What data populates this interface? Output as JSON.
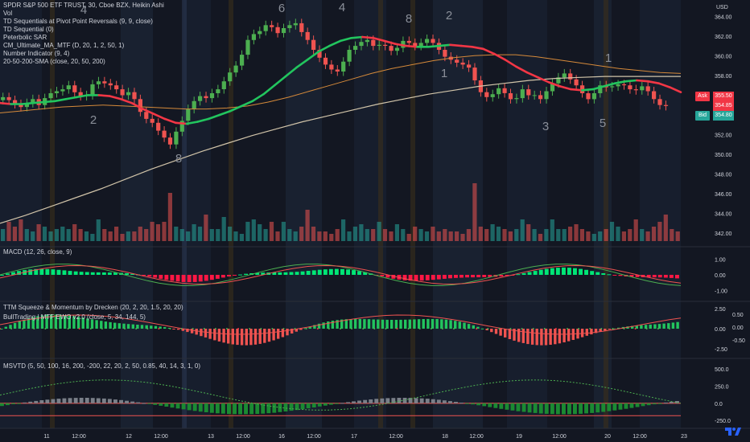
{
  "legend": {
    "title": "SPDR S&P 500 ETF TRUST, 30, Cboe BZX, Heikin Ashi",
    "lines": [
      "Vol",
      "TD Sequentials at Pivot Point Reversals (9, 9, close)",
      "TD Sequential (0)",
      "Peterbolic SAR",
      "CM_Ultimate_MA_MTF (D, 20, 1, 2, 50, 1)",
      "Number Indicator (9, 4)",
      "20-50-200-SMA (close, 20, 50, 200)"
    ]
  },
  "panes": {
    "price": {
      "currency": "USD",
      "ticks": [
        "364.00",
        "362.00",
        "360.00",
        "358.00",
        "356.00",
        "354.00",
        "352.00",
        "350.00",
        "348.00",
        "346.00",
        "344.00",
        "342.00"
      ],
      "tick_values": [
        364,
        362,
        360,
        358,
        356,
        354,
        352,
        350,
        348,
        346,
        344,
        342
      ],
      "range": [
        341.2,
        365
      ]
    },
    "macd": {
      "title": "MACD (12, 26, close, 9)",
      "ticks": [
        "1.00",
        "0.00",
        "-1.00"
      ],
      "tick_values": [
        1,
        0,
        -1
      ],
      "range": [
        -1.45,
        1.45
      ]
    },
    "ttm": {
      "title": "TTM Squeeze & Momentum by Drecken (20, 2, 20, 1.5, 20, 20)",
      "subtitle": "BullTrading | MTF EWO v2.0 (close, 5, 34, 144, 5)",
      "ticks": [
        "2.50",
        "0.00",
        "-2.50"
      ],
      "tick_values": [
        2.5,
        0,
        -2.5
      ],
      "right_ticks": [
        "0.50",
        "0.00",
        "-0.50"
      ],
      "right_values": [
        0.5,
        0,
        -0.5
      ],
      "range": [
        -3.3,
        3.3
      ]
    },
    "msvtd": {
      "title": "MSVTD (5, 50, 100, 16, 200, -200, 22, 20, 2, 50, 0.85, 40, 14, 3, 1, 0)",
      "ticks": [
        "500.0",
        "250.0",
        "0.0",
        "-250.0"
      ],
      "tick_values": [
        500,
        250,
        0,
        -250
      ],
      "range": [
        -330,
        560
      ]
    }
  },
  "price_tags": {
    "ask_label": "Ask",
    "ask": "355.50",
    "last": "354.85",
    "bid_label": "Bid",
    "bid": "354.80",
    "ask_color": "#f23645",
    "bid_color": "#26a69a"
  },
  "time_axis": {
    "labels": [
      "11",
      "12:00",
      "12",
      "12:00",
      "13",
      "12:00",
      "16",
      "12:00",
      "17",
      "12:00",
      "18",
      "12:00",
      "19",
      "12:00",
      "20",
      "12:00",
      "23"
    ]
  },
  "td_labels": [
    "4",
    "2",
    "8",
    "6",
    "4",
    "8",
    "2",
    "1",
    "3",
    "5",
    "1"
  ],
  "colors": {
    "up": "#4caf50",
    "down": "#ef5350",
    "ma_green": "#22c55e",
    "ma_red": "#f23645",
    "sma200": "#d1c4a9",
    "sma50": "#d68a3a",
    "bg": "#131722"
  },
  "chart_data": {
    "type": "candlestick",
    "title": "SPDR S&P 500 ETF TRUST, 30, Cboe BZX, Heikin Ashi",
    "interval": "30",
    "x": [
      "11",
      "12:00",
      "12",
      "12:00",
      "13",
      "12:00",
      "16",
      "12:00",
      "17",
      "12:00",
      "18",
      "12:00",
      "19",
      "12:00",
      "20",
      "12:00",
      "23"
    ],
    "close_path": [
      355.8,
      355.5,
      355.1,
      354.8,
      355.2,
      355.6,
      355.0,
      355.7,
      356.2,
      356.4,
      356.6,
      357.0,
      356.3,
      355.9,
      356.0,
      357.1,
      357.4,
      357.2,
      357.0,
      356.6,
      356.0,
      356.3,
      355.6,
      354.3,
      353.6,
      353.2,
      352.4,
      351.7,
      351.0,
      352.3,
      353.4,
      354.6,
      355.4,
      355.9,
      355.7,
      356.2,
      356.6,
      357.4,
      358.3,
      359.0,
      360.1,
      361.6,
      362.2,
      362.5,
      363.1,
      362.9,
      362.3,
      362.8,
      363.1,
      363.3,
      362.4,
      361.6,
      360.6,
      359.8,
      359.1,
      358.6,
      358.4,
      359.4,
      360.6,
      361.0,
      361.4,
      361.6,
      361.0,
      361.1,
      361.0,
      360.5,
      360.8,
      361.5,
      361.3,
      361.0,
      361.3,
      361.7,
      361.3,
      360.6,
      359.9,
      359.6,
      359.3,
      359.1,
      358.8,
      357.5,
      356.3,
      355.8,
      356.1,
      356.7,
      356.2,
      355.6,
      355.7,
      356.6,
      356.0,
      356.0,
      355.6,
      356.4,
      357.2,
      357.8,
      358.2,
      357.6,
      357.0,
      356.2,
      355.6,
      356.2,
      357.0,
      356.8,
      356.9,
      357.1,
      357.0,
      356.6,
      356.5,
      356.9,
      356.4,
      355.6,
      355.0,
      354.9
    ],
    "volume": [
      5,
      8,
      6,
      9,
      5,
      4,
      7,
      6,
      4,
      5,
      6,
      5,
      7,
      5,
      4,
      3,
      9,
      5,
      4,
      6,
      3,
      4,
      4,
      6,
      5,
      8,
      7,
      8,
      20,
      6,
      5,
      4,
      7,
      6,
      11,
      5,
      5,
      10,
      6,
      4,
      3,
      8,
      9,
      7,
      5,
      8,
      4,
      8,
      5,
      4,
      6,
      13,
      6,
      4,
      4,
      3,
      5,
      9,
      4,
      6,
      7,
      5,
      5,
      8,
      5,
      4,
      7,
      5,
      3,
      6,
      5,
      4,
      6,
      4,
      5,
      4,
      4,
      3,
      5,
      24,
      6,
      5,
      7,
      6,
      5,
      4,
      5,
      9,
      7,
      5,
      3,
      5,
      9,
      5,
      5,
      6,
      7,
      5,
      4,
      3,
      4,
      5,
      8,
      6,
      4,
      5,
      9,
      5,
      4,
      6,
      8,
      11,
      5,
      4
    ],
    "series": [
      {
        "name": "CM_Ultimate_MA_MTF",
        "values": [
          355.2,
          355.1,
          355.1,
          355.2,
          355.3,
          355.4,
          355.6,
          355.8,
          356.0,
          356.0,
          355.9,
          355.6,
          355.2,
          354.6,
          354.1,
          353.6,
          353.2,
          353.1,
          353.3,
          353.6,
          354.0,
          354.4,
          354.9,
          355.4,
          356.1,
          357.0,
          357.9,
          358.8,
          359.6,
          360.4,
          361.0,
          361.5,
          361.8,
          361.9,
          361.8,
          361.5,
          361.2,
          361.0,
          360.9,
          360.9,
          361.0,
          361.1,
          361.0,
          360.9,
          360.7,
          360.2,
          359.6,
          358.9,
          358.3,
          357.8,
          357.3,
          356.9,
          356.6,
          356.5,
          356.6,
          356.9,
          357.2,
          357.4,
          357.5,
          357.4,
          357.2,
          356.8,
          356.3
        ]
      },
      {
        "name": "SMA 50",
        "values": [
          354.2,
          354.4,
          354.6,
          354.8,
          354.9,
          355.0,
          354.9,
          354.8,
          354.7,
          354.6,
          354.6,
          354.7,
          354.9,
          355.3,
          355.8,
          356.4,
          357.0,
          357.6,
          358.2,
          358.7,
          359.1,
          359.5,
          359.8,
          360.0,
          360.1,
          360.1,
          359.9,
          359.6,
          359.3,
          359.0,
          358.7,
          358.5,
          358.3,
          358.2
        ]
      },
      {
        "name": "SMA 200",
        "values": [
          343.0,
          343.8,
          344.7,
          345.6,
          346.5,
          347.5,
          348.5,
          349.4,
          350.3,
          351.1,
          351.9,
          352.6,
          353.3,
          353.9,
          354.5,
          355.1,
          355.6,
          356.1,
          356.5,
          356.9,
          357.2,
          357.5,
          357.7,
          357.8,
          357.9,
          357.9,
          357.9,
          357.9
        ]
      }
    ],
    "ylim": [
      341.2,
      365
    ]
  }
}
